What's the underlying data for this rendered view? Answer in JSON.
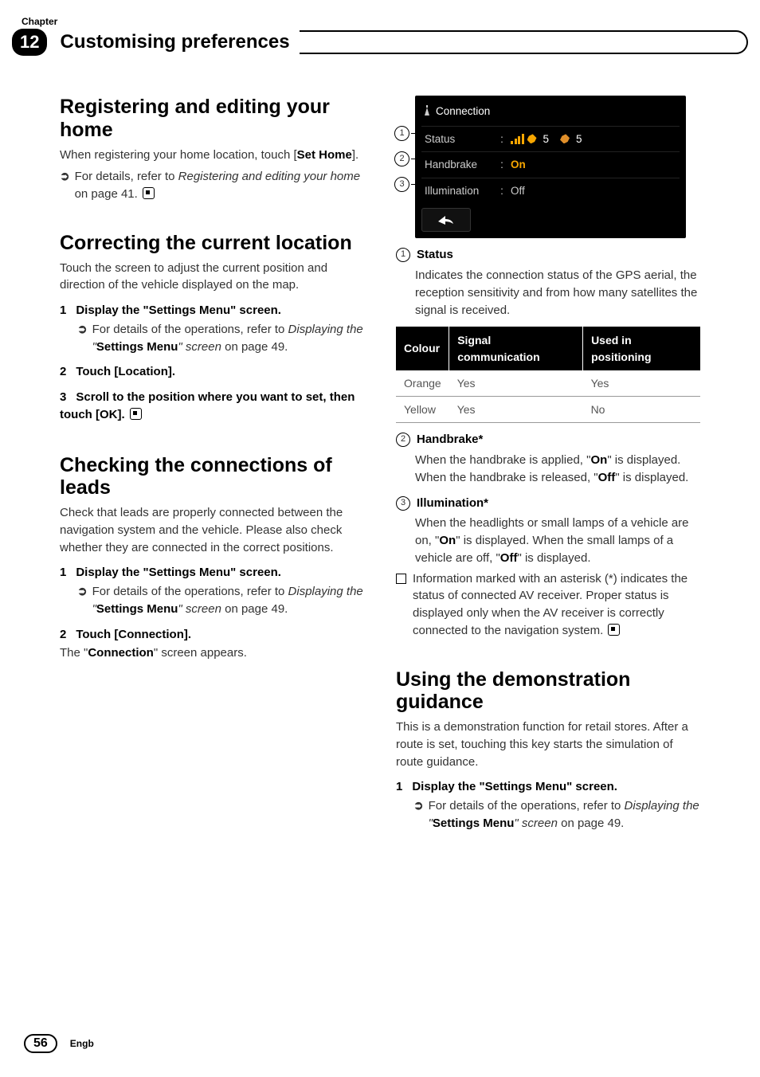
{
  "chapter_label": "Chapter",
  "chapter_number": "12",
  "header_title": "Customising preferences",
  "page_number": "56",
  "footer_lang": "Engb",
  "left": {
    "s1_title": "Registering and editing your home",
    "s1_p1a": "When registering your home location, touch [",
    "s1_p1b": "Set Home",
    "s1_p1c": "].",
    "s1_ref1a": "For details, refer to ",
    "s1_ref1b": "Registering and editing your home",
    "s1_ref1c": " on page 41.",
    "s2_title": "Correcting the current location",
    "s2_p1": "Touch the screen to adjust the current position and direction of the vehicle displayed on the map.",
    "s2_step1": "Display the \"Settings Menu\" screen.",
    "s2_ref1a": "For details of the operations, refer to ",
    "s2_ref1b": "Displaying the \"",
    "s2_ref1c": "Settings Menu",
    "s2_ref1d": "\" screen",
    "s2_ref1e": " on page 49.",
    "s2_step2": "Touch [Location].",
    "s2_step3": "Scroll to the position where you want to set, then touch [OK].",
    "s3_title": "Checking the connections of leads",
    "s3_p1": "Check that leads are properly connected between the navigation system and the vehicle. Please also check whether they are connected in the correct positions.",
    "s3_step1": "Display the \"Settings Menu\" screen.",
    "s3_ref1a": "For details of the operations, refer to ",
    "s3_ref1b": "Displaying the \"",
    "s3_ref1c": "Settings Menu",
    "s3_ref1d": "\" screen",
    "s3_ref1e": " on page 49.",
    "s3_step2": "Touch [Connection].",
    "s3_p2a": "The \"",
    "s3_p2b": "Connection",
    "s3_p2c": "\" screen appears."
  },
  "device": {
    "title": "Connection",
    "row1_label": "Status",
    "row1_sat1": "5",
    "row1_sat2": "5",
    "row2_label": "Handbrake",
    "row2_value": "On",
    "row3_label": "Illumination",
    "row3_value": "Off"
  },
  "right": {
    "leg1_num": "1",
    "leg1_title": "Status",
    "leg1_body": "Indicates the connection status of the GPS aerial, the reception sensitivity and from how many satellites the signal is received.",
    "table": {
      "h1": "Colour",
      "h2": "Signal communication",
      "h3": "Used in positioning",
      "r1c1": "Orange",
      "r1c2": "Yes",
      "r1c3": "Yes",
      "r2c1": "Yellow",
      "r2c2": "Yes",
      "r2c3": "No"
    },
    "leg2_num": "2",
    "leg2_title": "Handbrake*",
    "leg2_body_a": "When the handbrake is applied, \"",
    "leg2_body_b": "On",
    "leg2_body_c": "\" is displayed. When the handbrake is released, \"",
    "leg2_body_d": "Off",
    "leg2_body_e": "\" is displayed.",
    "leg3_num": "3",
    "leg3_title": "Illumination*",
    "leg3_body_a": "When the headlights or small lamps of a vehicle are on, \"",
    "leg3_body_b": "On",
    "leg3_body_c": "\" is displayed. When the small lamps of a vehicle are off, \"",
    "leg3_body_d": "Off",
    "leg3_body_e": "\" is displayed.",
    "note": "Information marked with an asterisk (*) indicates the status of connected AV receiver. Proper status is displayed only when the AV receiver is correctly connected to the navigation system.",
    "s4_title": "Using the demonstration guidance",
    "s4_p1": "This is a demonstration function for retail stores. After a route is set, touching this key starts the simulation of route guidance.",
    "s4_step1": "Display the \"Settings Menu\" screen.",
    "s4_ref1a": "For details of the operations, refer to ",
    "s4_ref1b": "Displaying the \"",
    "s4_ref1c": "Settings Menu",
    "s4_ref1d": "\" screen",
    "s4_ref1e": " on page 49."
  }
}
